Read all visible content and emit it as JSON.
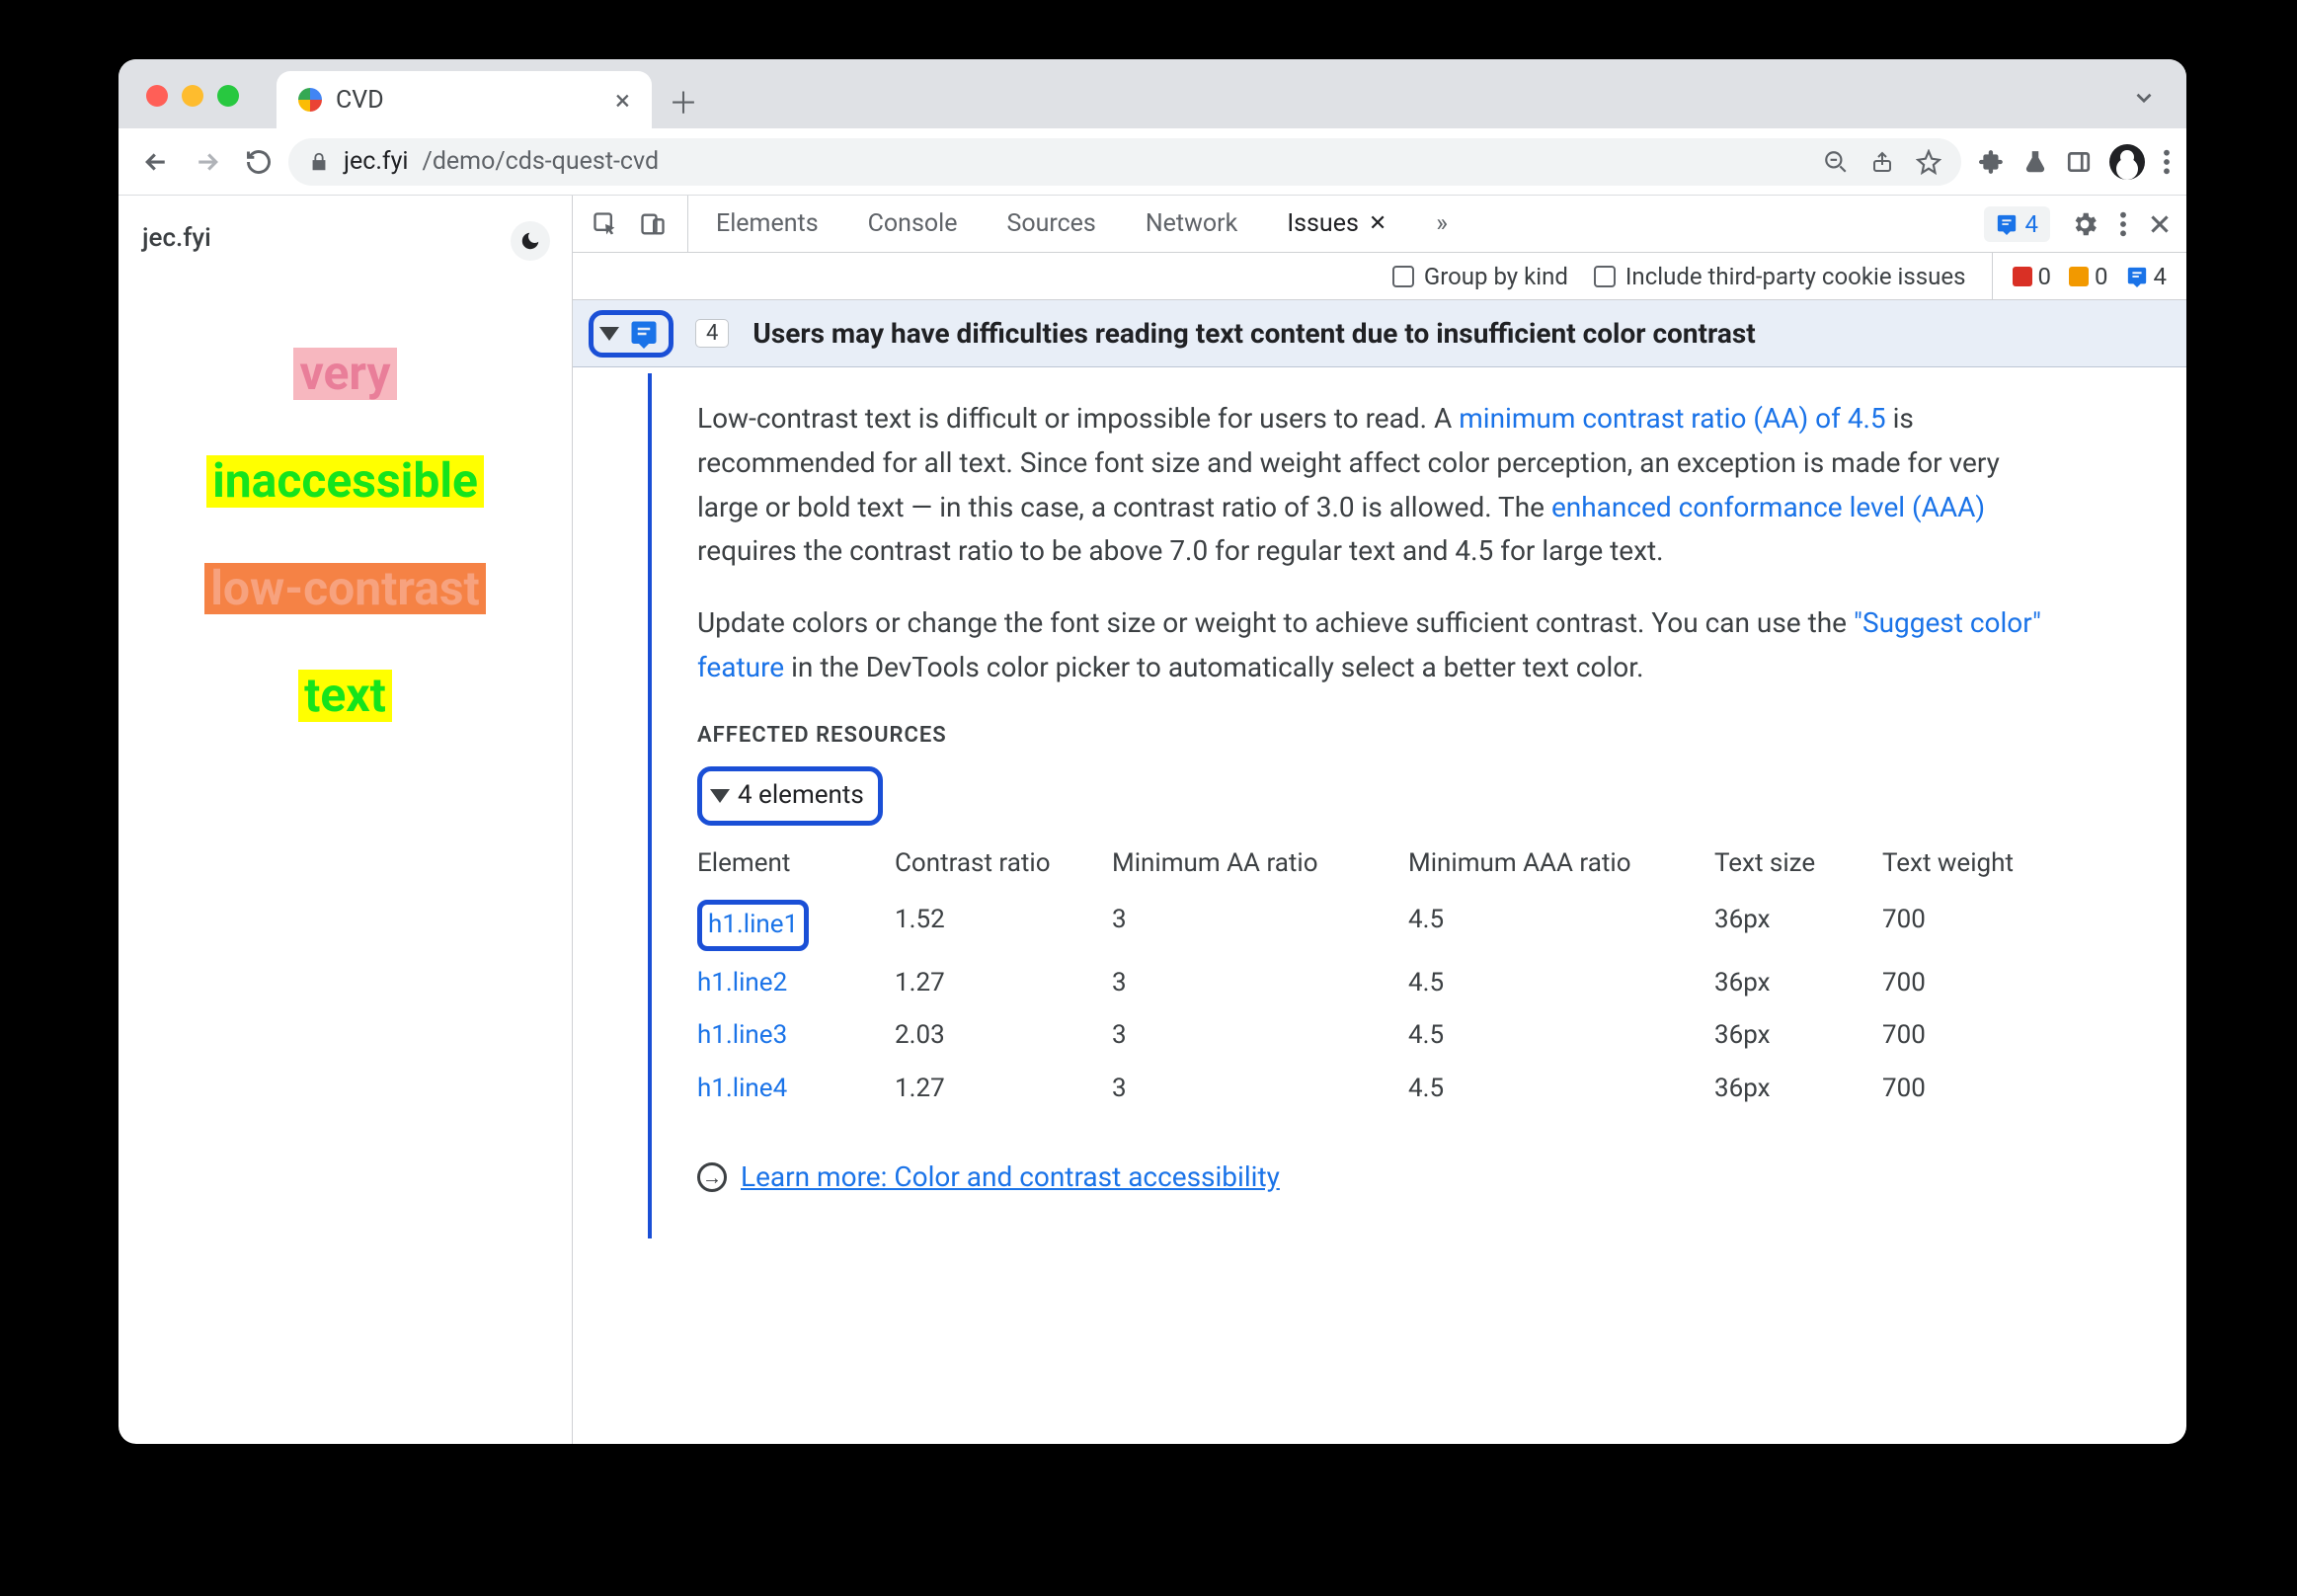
{
  "browser": {
    "tab_title": "CVD",
    "url_host": "jec.fyi",
    "url_path": "/demo/cds-quest-cvd"
  },
  "page": {
    "brand": "jec.fyi",
    "samples": [
      "very",
      "inaccessible",
      "low-contrast",
      "text"
    ]
  },
  "devtools": {
    "tabs": [
      "Elements",
      "Console",
      "Sources",
      "Network",
      "Issues"
    ],
    "issues_chip_count": "4",
    "filter": {
      "group_by_kind": "Group by kind",
      "third_party": "Include third-party cookie issues"
    },
    "counters": {
      "errors": "0",
      "warnings": "0",
      "info": "4"
    }
  },
  "issue": {
    "count": "4",
    "title": "Users may have difficulties reading text content due to insufficient color contrast",
    "p1_a": "Low-contrast text is difficult or impossible for users to read. A ",
    "p1_link": "minimum contrast ratio (AA) of 4.5",
    "p1_b": " is recommended for all text. Since font size and weight affect color perception, an exception is made for very large or bold text — in this case, a contrast ratio of 3.0 is allowed. The ",
    "p1_link2": "enhanced conformance level (AAA)",
    "p1_c": " requires the contrast ratio to be above 7.0 for regular text and 4.5 for large text.",
    "p2_a": "Update colors or change the font size or weight to achieve sufficient contrast. You can use the ",
    "p2_link": "\"Suggest color\" feature",
    "p2_b": " in the DevTools color picker to automatically select a better text color.",
    "affected_label": "AFFECTED RESOURCES",
    "elements_label": "4 elements",
    "table": {
      "headers": [
        "Element",
        "Contrast ratio",
        "Minimum AA ratio",
        "Minimum AAA ratio",
        "Text size",
        "Text weight"
      ],
      "rows": [
        {
          "el": "h1.line1",
          "cr": "1.52",
          "aa": "3",
          "aaa": "4.5",
          "size": "36px",
          "weight": "700"
        },
        {
          "el": "h1.line2",
          "cr": "1.27",
          "aa": "3",
          "aaa": "4.5",
          "size": "36px",
          "weight": "700"
        },
        {
          "el": "h1.line3",
          "cr": "2.03",
          "aa": "3",
          "aaa": "4.5",
          "size": "36px",
          "weight": "700"
        },
        {
          "el": "h1.line4",
          "cr": "1.27",
          "aa": "3",
          "aaa": "4.5",
          "size": "36px",
          "weight": "700"
        }
      ]
    },
    "learn_more": "Learn more: Color and contrast accessibility"
  }
}
